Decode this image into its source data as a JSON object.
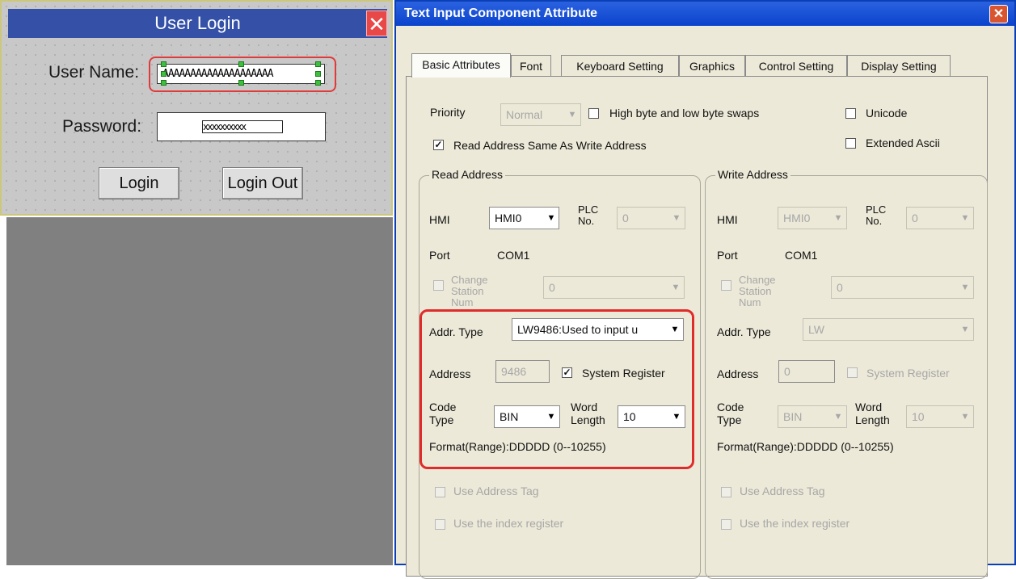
{
  "login": {
    "title": "User Login",
    "close_glyph": "✕",
    "username_label": "User Name:",
    "username_value": "AAAAAAAAAAAAAAAAAAAA",
    "password_label": "Password:",
    "password_value": "xxxxxxxxxx",
    "login_button": "Login",
    "logout_button": "Login Out"
  },
  "dialog": {
    "title": "Text Input Component Attribute",
    "close_glyph": "✕",
    "tabs": [
      {
        "label": "Basic Attributes",
        "active": true
      },
      {
        "label": "Font"
      },
      {
        "label": "Keyboard Setting"
      },
      {
        "label": "Graphics"
      },
      {
        "label": "Control Setting"
      },
      {
        "label": "Display Setting"
      }
    ],
    "priority_label": "Priority",
    "priority_value": "Normal",
    "byte_swap_label": "High byte and low byte swaps",
    "unicode_label": "Unicode",
    "read_same_label": "Read Address Same As Write Address",
    "extended_ascii_label": "Extended Ascii",
    "check_mark": "✓",
    "combo_arrow": "▼",
    "read": {
      "group_title": "Read Address",
      "hmi_label": "HMI",
      "hmi_value": "HMI0",
      "plc_label": "PLC No.",
      "plc_value": "0",
      "port_label": "Port",
      "port_value": "COM1",
      "change_station_label": "Change Station Num",
      "station_value": "0",
      "addr_type_label": "Addr. Type",
      "addr_type_value": "LW9486:Used to input u",
      "address_label": "Address",
      "address_value": "9486",
      "system_register_label": "System Register",
      "code_type_label": "Code Type",
      "code_type_value": "BIN",
      "word_length_label": "Word Length",
      "word_length_value": "10",
      "format_text": "Format(Range):DDDDD (0--10255)",
      "use_tag_label": "Use Address Tag",
      "use_index_label": "Use the index register"
    },
    "write": {
      "group_title": "Write Address",
      "hmi_label": "HMI",
      "hmi_value": "HMI0",
      "plc_label": "PLC No.",
      "plc_value": "0",
      "port_label": "Port",
      "port_value": "COM1",
      "change_station_label": "Change Station Num",
      "station_value": "0",
      "addr_type_label": "Addr. Type",
      "addr_type_value": "LW",
      "address_label": "Address",
      "address_value": "0",
      "system_register_label": "System Register",
      "code_type_label": "Code Type",
      "code_type_value": "BIN",
      "word_length_label": "Word Length",
      "word_length_value": "10",
      "format_text": "Format(Range):DDDDD (0--10255)",
      "use_tag_label": "Use Address Tag",
      "use_index_label": "Use the index register"
    }
  }
}
